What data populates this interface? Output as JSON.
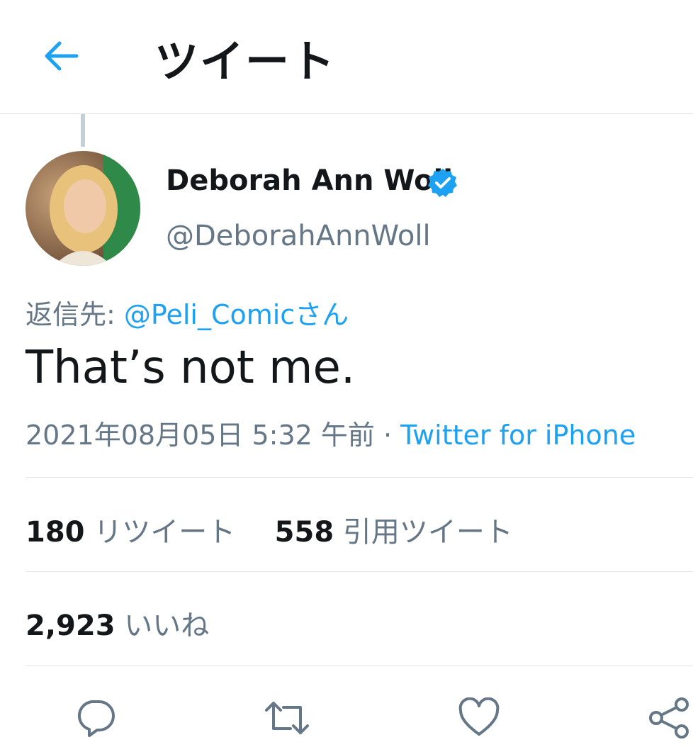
{
  "header": {
    "title": "ツイート"
  },
  "tweet": {
    "display_name": "Deborah Ann Woll",
    "handle": "@DeborahAnnWoll",
    "verified": true,
    "reply_prefix": "返信先: ",
    "reply_to": "@Peli_Comicさん",
    "text": "That’s not me.",
    "timestamp": "2021年08月05日 5:32 午前",
    "separator": " · ",
    "source": "Twitter for iPhone"
  },
  "stats": {
    "retweets": "180",
    "retweets_label": "リツイート",
    "quotes": "558",
    "quotes_label": "引用ツイート",
    "likes": "2,923",
    "likes_label": "いいね"
  },
  "colors": {
    "accent": "#1da1f2",
    "secondary_text": "#657786",
    "primary_text": "#14171a",
    "icon_gray": "#657786"
  },
  "icons": [
    "back-arrow-icon",
    "verified-badge-icon",
    "reply-icon",
    "retweet-icon",
    "like-icon",
    "share-icon"
  ]
}
